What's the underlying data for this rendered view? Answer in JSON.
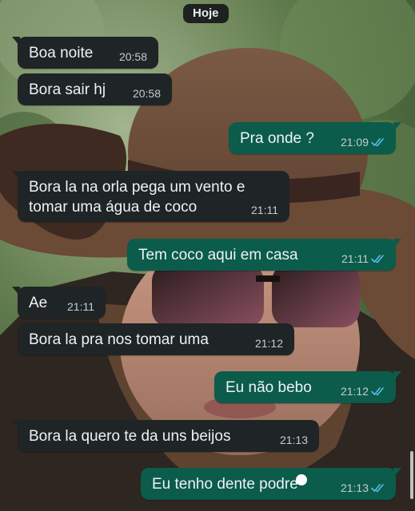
{
  "date_divider": "Hoje",
  "messages": [
    {
      "text": "Boa noite",
      "time": "20:58"
    },
    {
      "text": "Bora sair hj",
      "time": "20:58"
    },
    {
      "text": "Pra onde ?",
      "time": "21:09"
    },
    {
      "line1": "Bora la na orla pega um vento e",
      "line2": "tomar uma água de coco",
      "time": "21:11"
    },
    {
      "text": "Tem coco aqui em casa",
      "time": "21:11"
    },
    {
      "text": "Ae",
      "time": "21:11"
    },
    {
      "text": "Bora la pra nos tomar uma",
      "time": "21:12"
    },
    {
      "text": "Eu não bebo",
      "time": "21:12"
    },
    {
      "text": "Bora la quero te da uns beijos",
      "time": "21:13"
    },
    {
      "text": "Eu tenho dente podre",
      "time": "21:13"
    }
  ],
  "colors": {
    "incoming_bubble": "#1f2426",
    "outgoing_bubble": "#0b5c4a",
    "read_ticks": "#53bdeb",
    "text": "#f0f2f4",
    "timestamp": "#c6ccd0"
  },
  "icons": {
    "read_receipt": "double-check-icon",
    "wallpaper": "photo-wallpaper"
  }
}
